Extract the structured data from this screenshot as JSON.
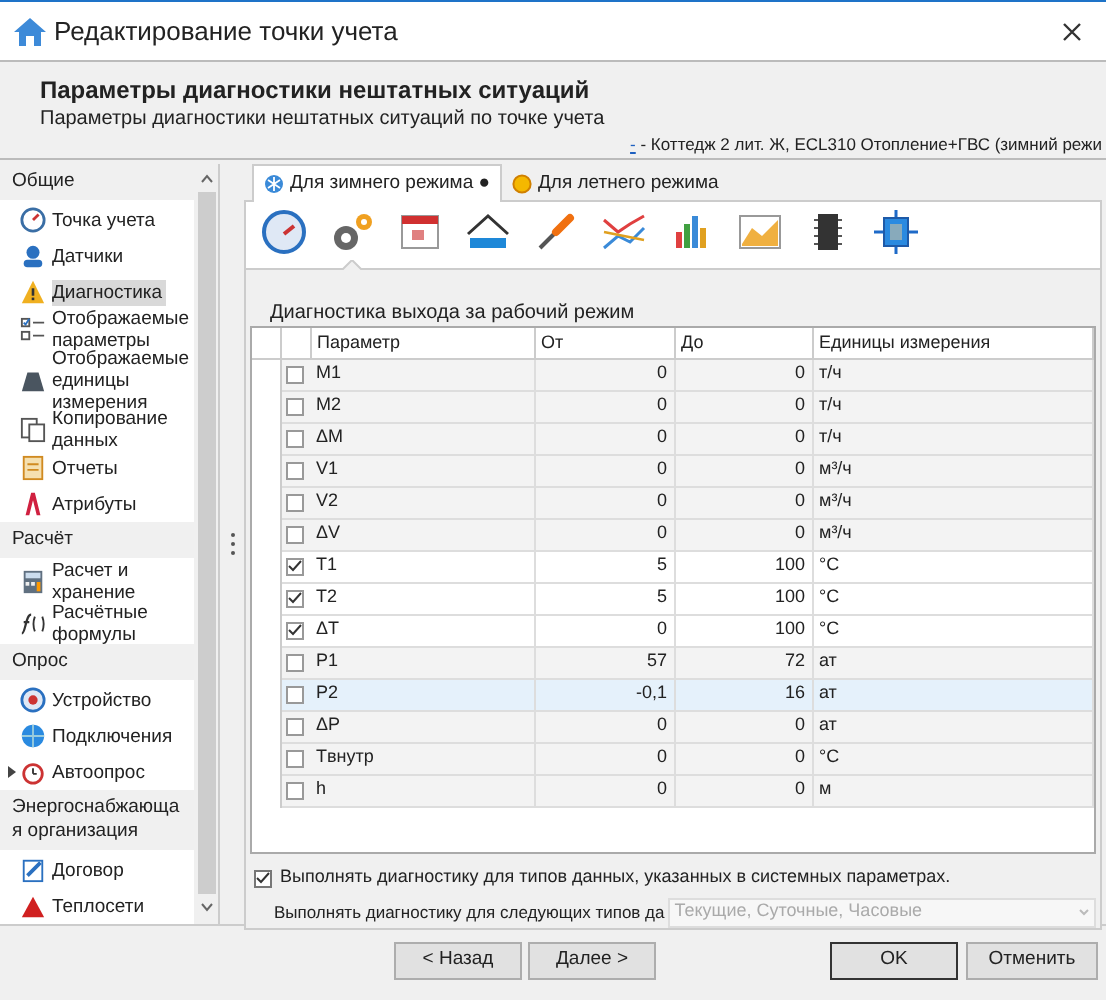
{
  "window": {
    "title": "Редактирование точки учета"
  },
  "header": {
    "title": "Параметры диагностики нештатных ситуаций",
    "subtitle": "Параметры диагностики нештатных ситуаций по точке учета",
    "path_link": "-",
    "path": " - Коттедж 2 лит. Ж, ECL310 Отопление+ГВС (зимний режи"
  },
  "sidebar": {
    "items": [
      {
        "kind": "group",
        "label": "Общие"
      },
      {
        "kind": "item",
        "label": "Точка учета",
        "selected": false
      },
      {
        "kind": "item",
        "label": "Датчики",
        "selected": false
      },
      {
        "kind": "item",
        "label": "Диагностика",
        "selected": true
      },
      {
        "kind": "item",
        "label": "Отображаемые параметры",
        "selected": false
      },
      {
        "kind": "item",
        "label": "Отображаемые единицы измерения",
        "selected": false
      },
      {
        "kind": "item",
        "label": "Копирование данных",
        "selected": false
      },
      {
        "kind": "item",
        "label": "Отчеты",
        "selected": false
      },
      {
        "kind": "item",
        "label": "Атрибуты",
        "selected": false
      },
      {
        "kind": "group",
        "label": "Расчёт"
      },
      {
        "kind": "item",
        "label": "Расчет и хранение",
        "selected": false
      },
      {
        "kind": "item",
        "label": "Расчётные формулы",
        "selected": false
      },
      {
        "kind": "group",
        "label": "Опрос"
      },
      {
        "kind": "item",
        "label": "Устройство",
        "selected": false
      },
      {
        "kind": "item",
        "label": "Подключения",
        "selected": false
      },
      {
        "kind": "item",
        "label": "Автоопрос",
        "selected": false,
        "expander": true
      },
      {
        "kind": "group",
        "label": "Энергоснабжающа я организация"
      },
      {
        "kind": "item",
        "label": "Договор",
        "selected": false
      },
      {
        "kind": "item",
        "label": "Теплосети",
        "selected": false
      }
    ]
  },
  "tabs": [
    {
      "label": "Для зимнего режима ●",
      "selected": true
    },
    {
      "label": "Для летнего режима",
      "selected": false
    }
  ],
  "toolbar": [
    {
      "selected": false
    },
    {
      "selected": true
    },
    {
      "selected": false
    },
    {
      "selected": false
    },
    {
      "selected": false
    },
    {
      "selected": false
    },
    {
      "selected": false
    },
    {
      "selected": false
    },
    {
      "selected": false
    },
    {
      "selected": false
    }
  ],
  "section_title": "Диагностика выхода за рабочий режим",
  "table": {
    "columns": [
      "Параметр",
      "От",
      "До",
      "Единицы измерения"
    ],
    "rows": [
      {
        "checked": false,
        "selected": false,
        "cells": [
          "M1",
          "0",
          "0",
          "т/ч"
        ]
      },
      {
        "checked": false,
        "selected": false,
        "cells": [
          "M2",
          "0",
          "0",
          "т/ч"
        ]
      },
      {
        "checked": false,
        "selected": false,
        "cells": [
          "ΔM",
          "0",
          "0",
          "т/ч"
        ]
      },
      {
        "checked": false,
        "selected": false,
        "cells": [
          "V1",
          "0",
          "0",
          "м³/ч"
        ]
      },
      {
        "checked": false,
        "selected": false,
        "cells": [
          "V2",
          "0",
          "0",
          "м³/ч"
        ]
      },
      {
        "checked": false,
        "selected": false,
        "cells": [
          "ΔV",
          "0",
          "0",
          "м³/ч"
        ]
      },
      {
        "checked": true,
        "selected": false,
        "cells": [
          "T1",
          "5",
          "100",
          "°C"
        ]
      },
      {
        "checked": true,
        "selected": false,
        "cells": [
          "T2",
          "5",
          "100",
          "°C"
        ]
      },
      {
        "checked": true,
        "selected": false,
        "cells": [
          "ΔT",
          "0",
          "100",
          "°C"
        ]
      },
      {
        "checked": false,
        "selected": false,
        "cells": [
          "P1",
          "57",
          "72",
          "ат"
        ]
      },
      {
        "checked": false,
        "selected": true,
        "cells": [
          "P2",
          "-0,1",
          "16",
          "ат"
        ]
      },
      {
        "checked": false,
        "selected": false,
        "cells": [
          "ΔP",
          "0",
          "0",
          "ат"
        ]
      },
      {
        "checked": false,
        "selected": false,
        "cells": [
          "Tвнутр",
          "0",
          "0",
          "°C"
        ]
      },
      {
        "checked": false,
        "selected": false,
        "cells": [
          "h",
          "0",
          "0",
          "м"
        ]
      }
    ]
  },
  "system_check": {
    "label": "Выполнять диагностику для типов данных, указанных в системных параметрах.",
    "checked": true
  },
  "types_field": {
    "label": "Выполнять диагностику для следующих типов да",
    "value": "Текущие, Суточные, Часовые",
    "disabled": true
  },
  "buttons": [
    {
      "label": "< Назад",
      "default": false
    },
    {
      "label": "Далее >",
      "default": false
    },
    {
      "label": "OK",
      "default": true
    },
    {
      "label": "Отменить",
      "default": false
    }
  ]
}
